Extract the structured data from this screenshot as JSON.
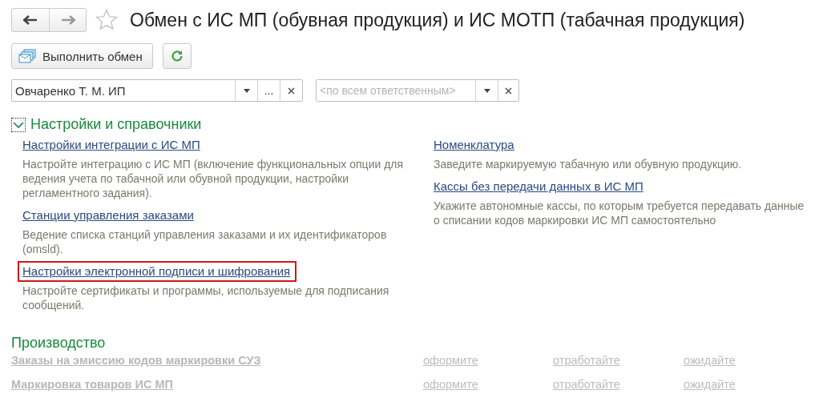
{
  "window": {
    "title": "Обмен с ИС МП (обувная продукция) и ИС МОТП (табачная продукция)",
    "favorite": false
  },
  "toolbar": {
    "exchange_button": "Выполнить обмен"
  },
  "filters": {
    "organization": {
      "value": "Овчаренко Т. М. ИП",
      "select_button": "..."
    },
    "responsible": {
      "placeholder": "<по всем ответственным>"
    }
  },
  "settings_section": {
    "title": "Настройки и справочники",
    "expanded": true,
    "left_items": [
      {
        "link": "Настройки интеграции с ИС МП",
        "description": "Настройте интеграцию с ИС МП (включение функциональных опции для ведения учета по табачной или обувной продукции, настройки регламентного задания).",
        "highlighted": false
      },
      {
        "link": "Станции управления заказами",
        "description": "Ведение списка станций управления заказами и их идентификаторов (omsld).",
        "highlighted": false
      },
      {
        "link": "Настройки электронной подписи и шифрования",
        "description": "Настройте сертификаты и программы, используемые для подписания сообщений.",
        "highlighted": true
      }
    ],
    "right_items": [
      {
        "link": "Номенклатура",
        "description": "Заведите маркируемую табачную или обувную продукцию.",
        "highlighted": false
      },
      {
        "link": "Кассы без передачи данных в ИС МП",
        "description": "Укажите автономные кассы, по которым требуется передавать данные о списании кодов маркировки ИС МП самостоятельно",
        "highlighted": false
      }
    ]
  },
  "production_section": {
    "title": "Производство",
    "rows": [
      {
        "name": "Заказы на эмиссию кодов маркировки СУЗ",
        "disabled": true,
        "statuses": [
          "оформите",
          "отработайте",
          "ожидайте"
        ]
      },
      {
        "name": "Маркировка товаров ИС МП",
        "disabled": true,
        "statuses": [
          "оформите",
          "отработайте",
          "ожидайте"
        ]
      }
    ]
  }
}
